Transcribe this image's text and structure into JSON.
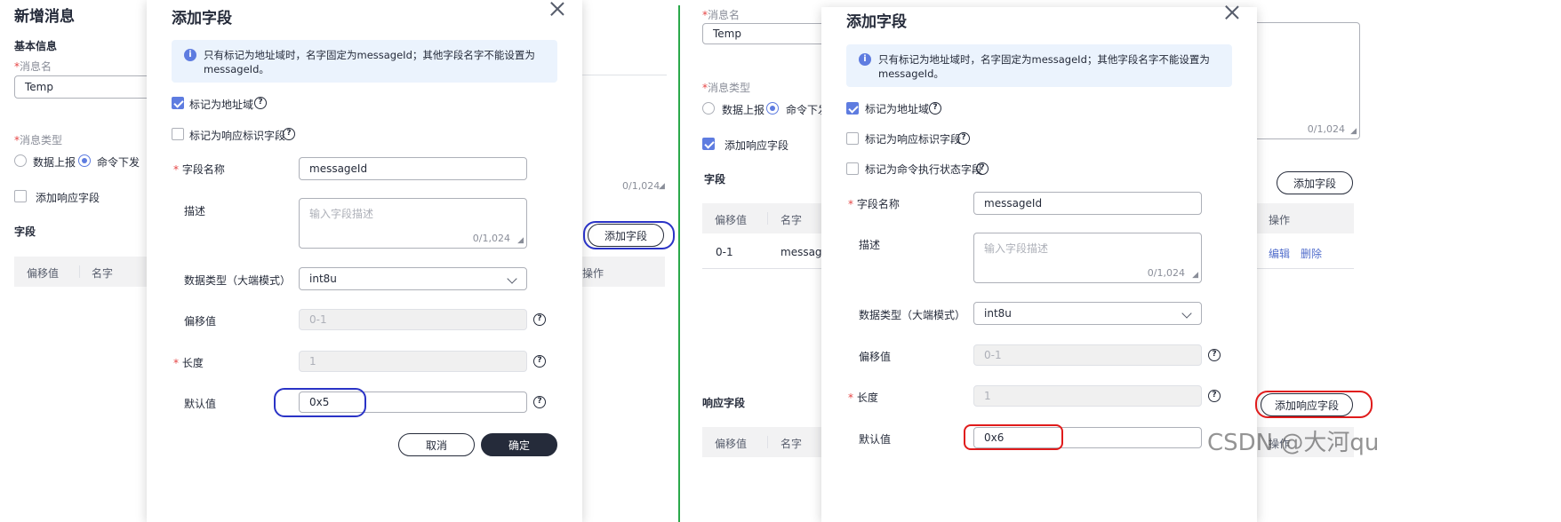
{
  "left": {
    "page_title": "新增消息",
    "section_basic": "基本信息",
    "msg_name_label": "消息名",
    "msg_name_value": "Temp",
    "msg_type_label": "消息类型",
    "radio_report": "数据上报",
    "radio_command": "命令下发",
    "add_response_label": "添加响应字段",
    "fields_label": "字段",
    "counter": "0/1,024",
    "add_field_button": "添加字段",
    "col_offset": "偏移值",
    "col_name": "名字",
    "col_action": "操作"
  },
  "dialog1": {
    "title": "添加字段",
    "info": "只有标记为地址域时，名字固定为messageId；其他字段名字不能设置为messageId。",
    "mark_address": "标记为地址域",
    "mark_response": "标记为响应标识字段",
    "field_name_label": "字段名称",
    "field_name_value": "messageId",
    "desc_label": "描述",
    "desc_placeholder": "输入字段描述",
    "desc_counter": "0/1,024",
    "datatype_label": "数据类型（大端模式）",
    "datatype_value": "int8u",
    "offset_label": "偏移值",
    "offset_value": "0-1",
    "length_label": "长度",
    "length_value": "1",
    "default_label": "默认值",
    "default_value": "0x5",
    "cancel_button": "取消",
    "ok_button": "确定"
  },
  "right": {
    "msg_name_label": "消息名",
    "msg_name_value": "Temp",
    "msg_type_label": "消息类型",
    "radio_report": "数据上报",
    "radio_command": "命令下发",
    "add_response_label": "添加响应字段",
    "fields_label": "字段",
    "counter": "0/1,024",
    "add_field_button": "添加字段",
    "col_offset": "偏移值",
    "col_name": "名字",
    "col_action": "操作",
    "row_offset": "0-1",
    "row_name": "message",
    "edit_link": "编辑",
    "delete_link": "删除",
    "response_fields_label": "响应字段",
    "add_response_button": "添加响应字段"
  },
  "dialog2": {
    "title": "添加字段",
    "info": "只有标记为地址域时，名字固定为messageId；其他字段名字不能设置为messageId。",
    "mark_address": "标记为地址域",
    "mark_response": "标记为响应标识字段",
    "mark_cmd_status": "标记为命令执行状态字段",
    "field_name_label": "字段名称",
    "field_name_value": "messageId",
    "desc_label": "描述",
    "desc_placeholder": "输入字段描述",
    "desc_counter": "0/1,024",
    "datatype_label": "数据类型（大端模式）",
    "datatype_value": "int8u",
    "offset_label": "偏移值",
    "offset_value": "0-1",
    "length_label": "长度",
    "length_value": "1",
    "default_label": "默认值",
    "default_value": "0x6"
  },
  "watermark": "CSDN @大河qu",
  "colors": {
    "accent": "#5e7ce0",
    "primary_button": "#252b3a",
    "annotation_blue": "#2a33c6",
    "annotation_red": "#e01b1b",
    "divider_green": "#2aa84a"
  }
}
